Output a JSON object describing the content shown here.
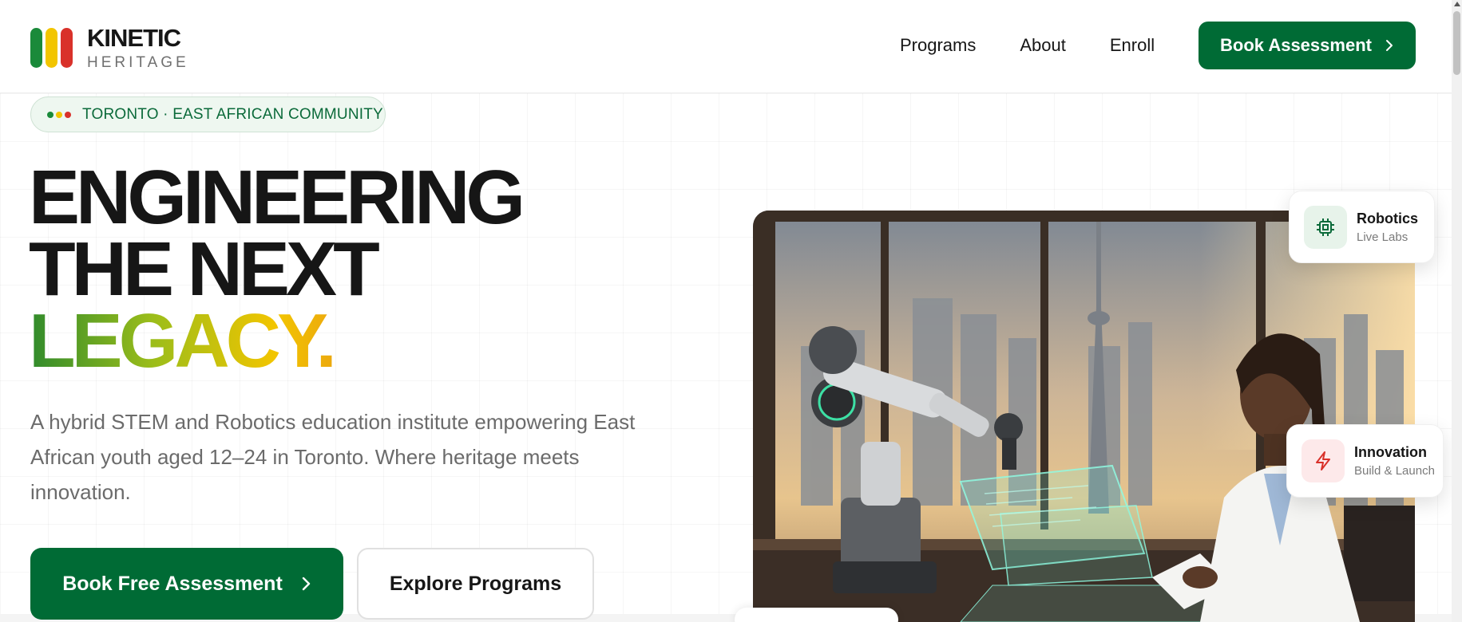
{
  "brand": {
    "name": "KINETIC",
    "subtitle": "HERITAGE",
    "logo_colors": [
      "#1a8a3a",
      "#f2c500",
      "#d9312a"
    ]
  },
  "nav": {
    "items": [
      {
        "label": "Programs"
      },
      {
        "label": "About"
      },
      {
        "label": "Enroll"
      }
    ],
    "cta_label": "Book Assessment"
  },
  "hero": {
    "badge": "TORONTO · EAST AFRICAN COMMUNITY",
    "badge_dot_colors": [
      "#1a8a3a",
      "#f2c500",
      "#d9312a"
    ],
    "headline_line1": "ENGINEERING",
    "headline_line2": "THE NEXT",
    "headline_line3": "LEGACY.",
    "description": "A hybrid STEM and Robotics education institute empowering East African youth aged 12–24 in Toronto. Where heritage meets innovation.",
    "primary_cta": "Book Free Assessment",
    "secondary_cta": "Explore Programs"
  },
  "cards": {
    "robotics": {
      "title": "Robotics",
      "subtitle": "Live Labs",
      "icon": "cpu-chip-icon"
    },
    "innovation": {
      "title": "Innovation",
      "subtitle": "Build & Launch",
      "icon": "lightning-bolt-icon"
    }
  },
  "colors": {
    "primary_green": "#006b35",
    "text_dark": "#161616",
    "text_muted": "#6b6b6b"
  }
}
